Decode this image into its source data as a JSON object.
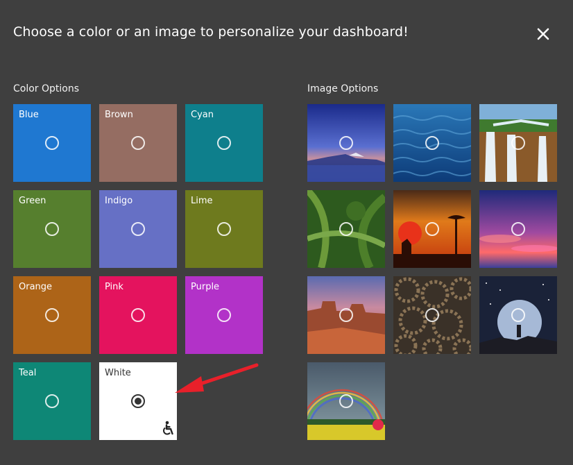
{
  "dialog": {
    "title": "Choose a color or an image to personalize your dashboard!",
    "close_icon": "close-icon"
  },
  "colors": {
    "section_label": "Color Options",
    "items": [
      {
        "label": "Blue",
        "color": "#1f78d1",
        "selected": false
      },
      {
        "label": "Brown",
        "color": "#956d62",
        "selected": false
      },
      {
        "label": "Cyan",
        "color": "#0e7f8c",
        "selected": false
      },
      {
        "label": "Green",
        "color": "#567f2e",
        "selected": false
      },
      {
        "label": "Indigo",
        "color": "#6670c5",
        "selected": false
      },
      {
        "label": "Lime",
        "color": "#6e7a1e",
        "selected": false
      },
      {
        "label": "Orange",
        "color": "#ad6418",
        "selected": false
      },
      {
        "label": "Pink",
        "color": "#e4135e",
        "selected": false
      },
      {
        "label": "Purple",
        "color": "#b232c8",
        "selected": false
      },
      {
        "label": "Teal",
        "color": "#0e8776",
        "selected": false
      },
      {
        "label": "White",
        "color": "#ffffff",
        "selected": true
      }
    ]
  },
  "images": {
    "section_label": "Image Options",
    "items": [
      {
        "name": "blue-lake-mountains-image"
      },
      {
        "name": "ocean-water-image"
      },
      {
        "name": "waterfall-cliffs-image"
      },
      {
        "name": "green-jungle-image"
      },
      {
        "name": "orange-sunset-savanna-image"
      },
      {
        "name": "pink-sky-clouds-image"
      },
      {
        "name": "desert-canyon-image"
      },
      {
        "name": "bronze-gears-image"
      },
      {
        "name": "moon-night-sky-image"
      },
      {
        "name": "rainbow-meadow-image"
      }
    ]
  },
  "annotation": {
    "icon": "red-arrow-icon",
    "color": "#e8202a"
  }
}
